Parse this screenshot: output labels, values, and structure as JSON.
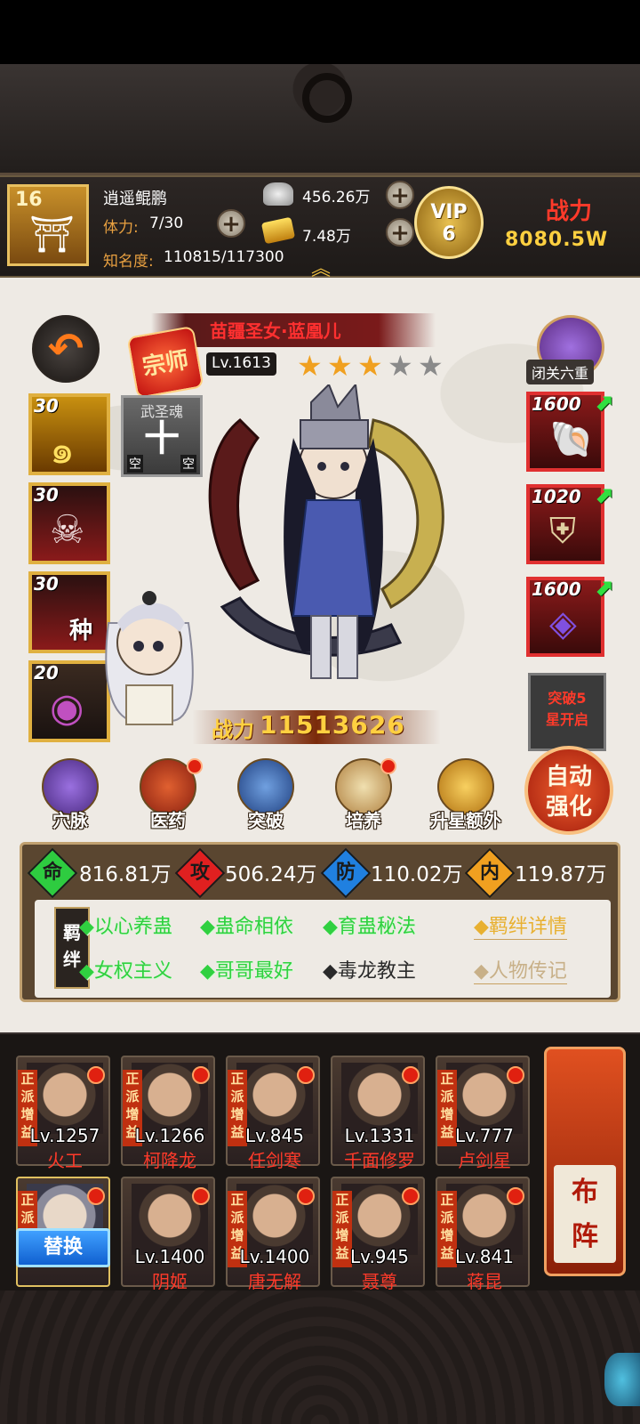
{
  "player": {
    "level": "16",
    "name": "逍遥鲲鹏",
    "stamina_label": "体力:",
    "stamina": "7/30",
    "fame_label": "知名度:",
    "fame": "110815/117300",
    "silver": "456.26万",
    "gold": "7.48万",
    "vip_text": "VIP",
    "vip_level": "6",
    "power_label": "战力",
    "power": "8080.5W"
  },
  "hero": {
    "name": "苗疆圣女·蓝凰儿",
    "rank": "宗师",
    "level": "Lv.1613",
    "stars_total": 5,
    "stars_filled": 3,
    "meditation_label": "闭关六重",
    "battle_power_label": "战力",
    "battle_power": "11513626"
  },
  "skills": [
    {
      "level": "30",
      "icon": "swirl-icon"
    },
    {
      "level": "30",
      "icon": "skull-icon"
    },
    {
      "level": "30",
      "icon": "blood-seed-icon",
      "seed_text": "种"
    },
    {
      "level": "20",
      "icon": "orb-icon"
    }
  ],
  "soul": {
    "title": "武圣魂",
    "char": "十",
    "empty_left": "空",
    "empty_right": "空"
  },
  "equipment": [
    {
      "level": "1600",
      "icon": "shell-icon"
    },
    {
      "level": "1020",
      "icon": "armor-icon"
    },
    {
      "level": "1600",
      "icon": "gem-icon"
    }
  ],
  "breakthrough_text": "突破5星开启",
  "functions": [
    {
      "label": "穴脉",
      "has_dot": false
    },
    {
      "label": "医药",
      "has_dot": true
    },
    {
      "label": "突破",
      "has_dot": false
    },
    {
      "label": "培养",
      "has_dot": true
    },
    {
      "label": "升星额外",
      "has_dot": false
    }
  ],
  "auto_enhance": "自动强化",
  "attributes": [
    {
      "badge": "命",
      "value": "816.81万",
      "color": "#2ecc40"
    },
    {
      "badge": "攻",
      "value": "506.24万",
      "color": "#e02020"
    },
    {
      "badge": "防",
      "value": "110.02万",
      "color": "#2080e0"
    },
    {
      "badge": "内",
      "value": "119.87万",
      "color": "#f0a020"
    }
  ],
  "bond": {
    "tag": "羁绊",
    "items": [
      {
        "text": "◆以心养蛊",
        "active": true
      },
      {
        "text": "◆蛊命相依",
        "active": true
      },
      {
        "text": "◆育蛊秘法",
        "active": true
      },
      {
        "text": "◆女权主义",
        "active": true
      },
      {
        "text": "◆哥哥最好",
        "active": true
      },
      {
        "text": "◆毒龙教主",
        "active": false
      }
    ],
    "details_link": "◆羁绊详情",
    "biography_link": "◆人物传记"
  },
  "team_tag": "正派增益",
  "team": [
    {
      "level": "Lv.1257",
      "name": "火工",
      "tag": true
    },
    {
      "level": "Lv.1266",
      "name": "柯降龙",
      "tag": true
    },
    {
      "level": "Lv.845",
      "name": "任剑寒",
      "tag": true
    },
    {
      "level": "Lv.1331",
      "name": "千面修罗",
      "tag": false
    },
    {
      "level": "Lv.777",
      "name": "卢剑星",
      "tag": true
    },
    {
      "level": "",
      "name": "",
      "tag": true
    },
    {
      "level": "Lv.1400",
      "name": "阴姬",
      "tag": false
    },
    {
      "level": "Lv.1400",
      "name": "唐无解",
      "tag": true
    },
    {
      "level": "Lv.945",
      "name": "聂尊",
      "tag": true
    },
    {
      "level": "Lv.841",
      "name": "蒋昆",
      "tag": true
    }
  ],
  "replace_label": "替换",
  "formation_label": "布阵"
}
